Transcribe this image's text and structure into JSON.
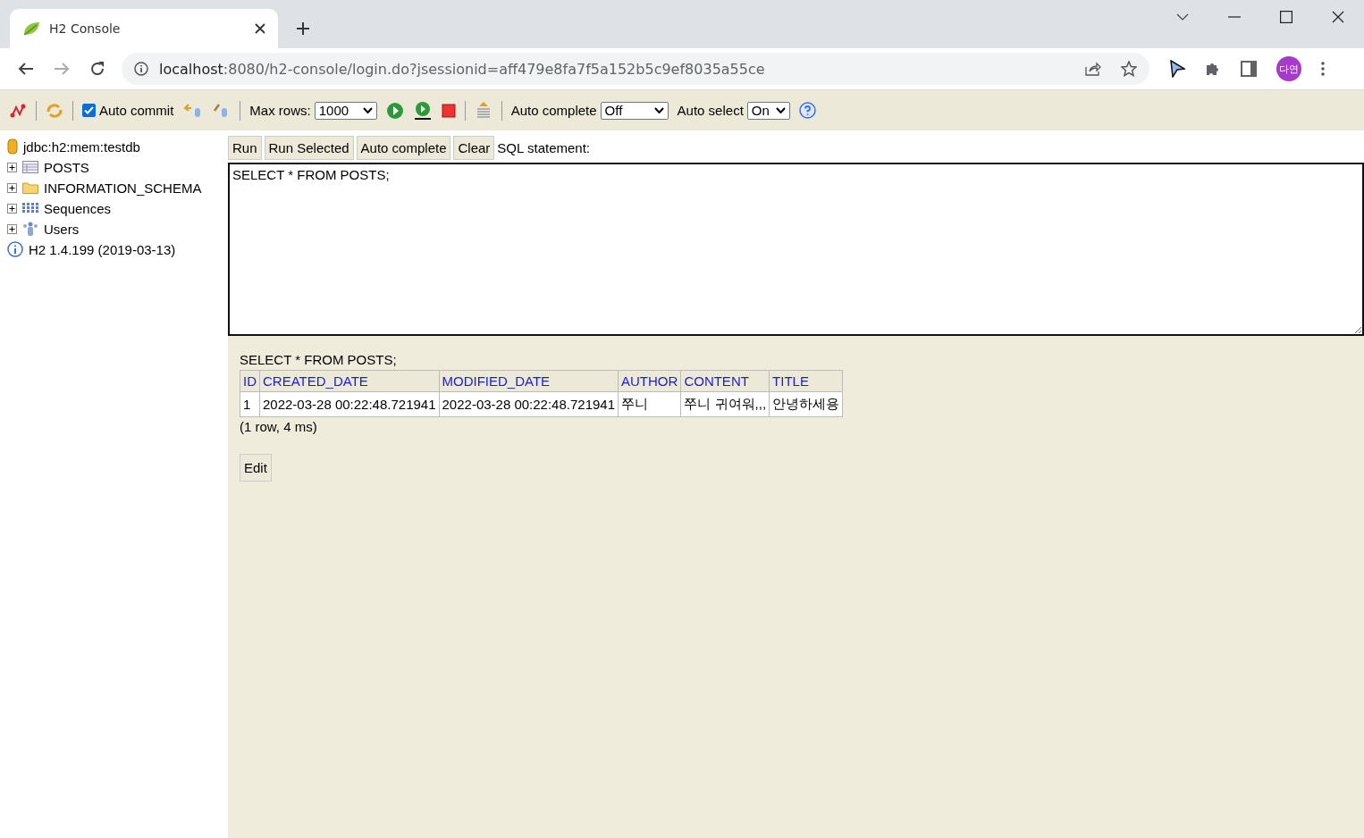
{
  "browser": {
    "tab_title": "H2 Console",
    "url_host": "localhost",
    "url_rest": ":8080/h2-console/login.do?jsessionid=aff479e8fa7f5a152b5c9ef8035a55ce",
    "profile": "다연"
  },
  "toolbar": {
    "auto_commit": {
      "label": "Auto commit",
      "checked": true
    },
    "max_rows": {
      "label": "Max rows:",
      "value": "1000"
    },
    "auto_complete": {
      "label": "Auto complete",
      "value": "Off"
    },
    "auto_select": {
      "label": "Auto select",
      "value": "On"
    }
  },
  "tree": {
    "connection": "jdbc:h2:mem:testdb",
    "nodes": [
      {
        "kind": "table",
        "label": "POSTS",
        "expanded": false
      },
      {
        "kind": "folder",
        "label": "INFORMATION_SCHEMA",
        "expanded": false
      },
      {
        "kind": "sequences",
        "label": "Sequences",
        "expanded": false
      },
      {
        "kind": "users",
        "label": "Users",
        "expanded": false
      }
    ],
    "version": "H2 1.4.199 (2019-03-13)"
  },
  "editor": {
    "buttons": [
      "Run",
      "Run Selected",
      "Auto complete",
      "Clear"
    ],
    "label": "SQL statement:",
    "sql": "SELECT * FROM POSTS;"
  },
  "result": {
    "query": "SELECT * FROM POSTS;",
    "columns": [
      "ID",
      "CREATED_DATE",
      "MODIFIED_DATE",
      "AUTHOR",
      "CONTENT",
      "TITLE"
    ],
    "rows": [
      [
        "1",
        "2022-03-28 00:22:48.721941",
        "2022-03-28 00:22:48.721941",
        "쭈니",
        "쭈니 귀여워,,,",
        "안녕하세용"
      ]
    ],
    "summary": "(1 row, 4 ms)",
    "edit_button": "Edit"
  }
}
